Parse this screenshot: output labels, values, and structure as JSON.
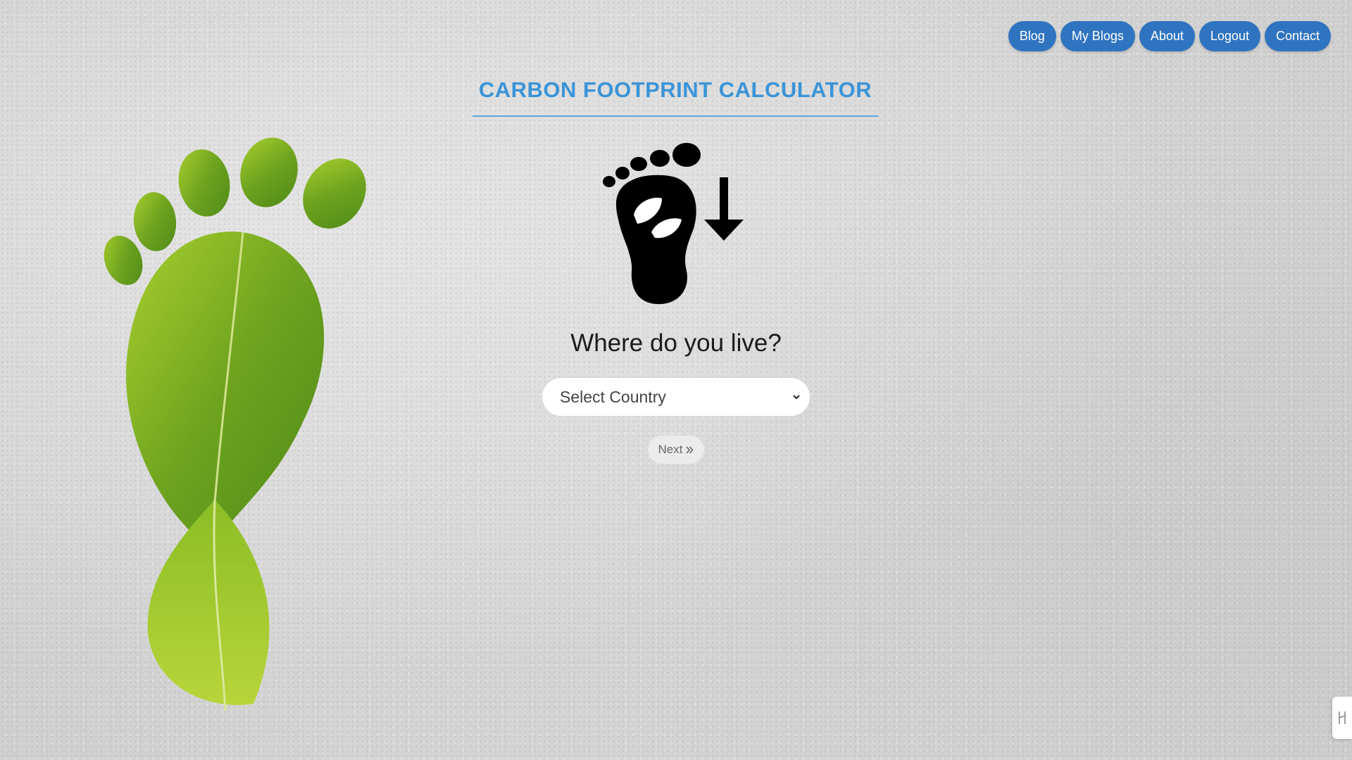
{
  "nav": {
    "items": [
      {
        "label": "Blog"
      },
      {
        "label": "My Blogs"
      },
      {
        "label": "About"
      },
      {
        "label": "Logout"
      },
      {
        "label": "Contact"
      }
    ]
  },
  "page": {
    "title": "CARBON FOOTPRINT CALCULATOR",
    "question": "Where do you live?"
  },
  "country_select": {
    "selected": "Select Country"
  },
  "next_button": {
    "label": "Next",
    "icon": "double-chevron-right-icon"
  },
  "colors": {
    "nav_button": "#2f74c0",
    "title": "#3a94d8",
    "leaf_green": "#7fb021"
  }
}
